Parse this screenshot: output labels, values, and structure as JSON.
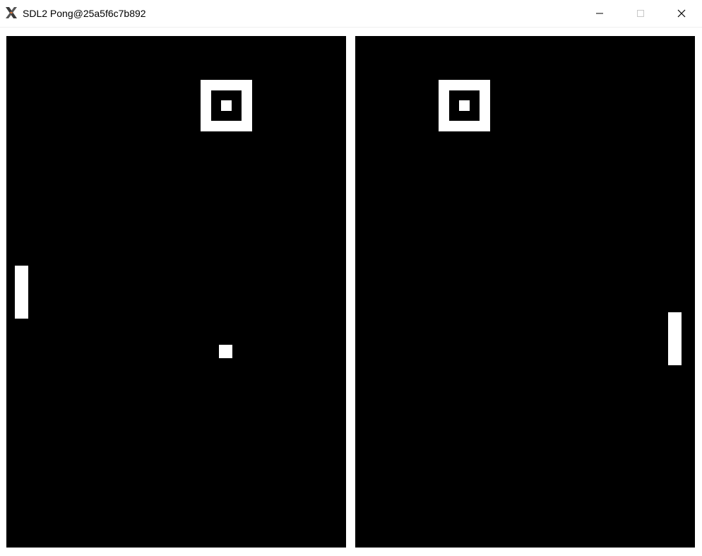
{
  "window": {
    "title": "SDL2 Pong@25a5f6c7b892",
    "icon": "x11-icon",
    "controls": {
      "minimize": "minimize-icon",
      "maximize": "maximize-icon",
      "close": "close-icon"
    }
  },
  "game": {
    "background_color": "#000000",
    "foreground_color": "#ffffff",
    "left_view": {
      "objects": [
        "target",
        "paddle",
        "ball"
      ]
    },
    "right_view": {
      "objects": [
        "target",
        "paddle"
      ]
    }
  }
}
